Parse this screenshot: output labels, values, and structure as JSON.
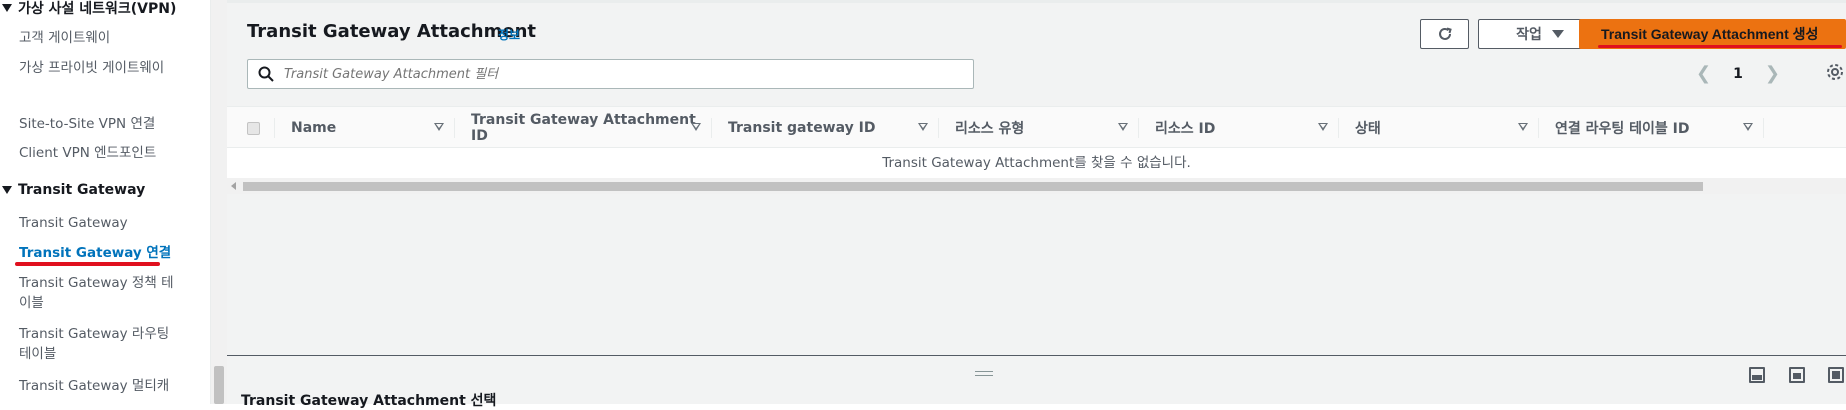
{
  "sidebar": {
    "vpn_section": "가상 사설 네트워크(VPN)",
    "vpn_items": [
      "고객 게이트웨이",
      "가상 프라이빗 게이트웨이",
      "Site-to-Site VPN 연결",
      "Client VPN 엔드포인트"
    ],
    "tgw_section": "Transit Gateway",
    "tgw_items": [
      "Transit Gateway",
      "Transit Gateway 연결",
      "Transit Gateway 정책 테이블",
      "Transit Gateway 라우팅 테이블",
      "Transit Gateway 멀티캐"
    ]
  },
  "header": {
    "title": "Transit Gateway Attachment",
    "info": "정보",
    "action_label": "작업",
    "create_label": "Transit Gateway Attachment 생성"
  },
  "search": {
    "placeholder": "Transit Gateway Attachment 필터"
  },
  "pager": {
    "page": "1"
  },
  "table": {
    "columns": [
      "Name",
      "Transit Gateway Attachment ID",
      "Transit gateway ID",
      "리소스 유형",
      "리소스 ID",
      "상태",
      "연결 라우팅 테이블 ID"
    ],
    "empty_message": "Transit Gateway Attachment를 찾을 수 없습니다."
  },
  "bottom": {
    "title": "Transit Gateway Attachment 선택"
  },
  "colors": {
    "primary_button": "#ec7211",
    "link": "#0073bb",
    "highlight_underline": "#e0101e"
  }
}
